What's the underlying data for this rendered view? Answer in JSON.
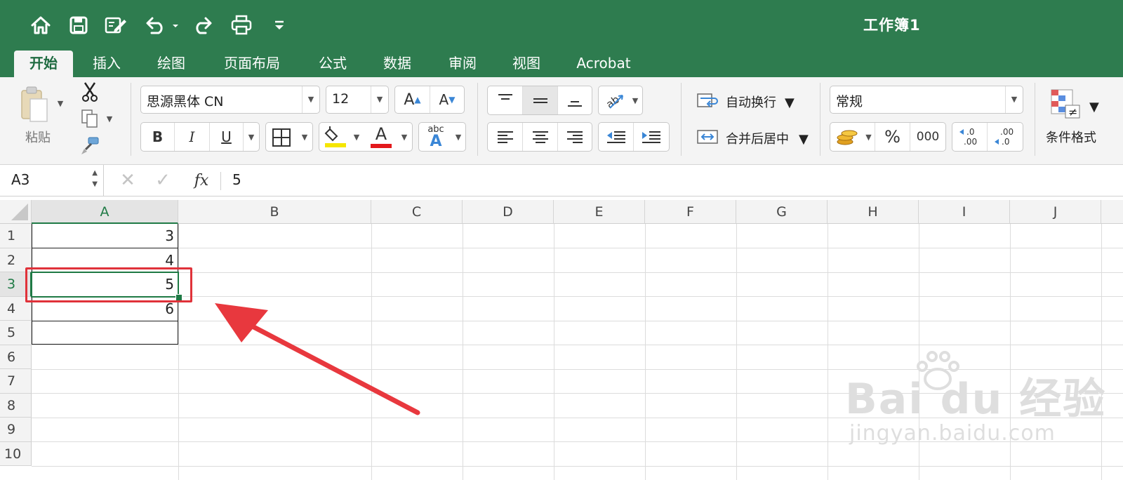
{
  "title_bar": {
    "workbook_title": "工作簿1",
    "quick_access": [
      "home-icon",
      "save-icon",
      "edit-icon",
      "undo-icon",
      "redo-icon",
      "print-icon",
      "customize-icon"
    ],
    "background": "#2e7c4f"
  },
  "tabs": [
    {
      "label": "开始",
      "active": true
    },
    {
      "label": "插入"
    },
    {
      "label": "绘图"
    },
    {
      "label": "页面布局"
    },
    {
      "label": "公式"
    },
    {
      "label": "数据"
    },
    {
      "label": "审阅"
    },
    {
      "label": "视图"
    },
    {
      "label": "Acrobat"
    }
  ],
  "ribbon": {
    "paste_label": "粘贴",
    "font_name": "思源黑体 CN",
    "font_size": "12",
    "bold": "B",
    "italic": "I",
    "underline": "U",
    "font_color_glyph": "A",
    "phonetic_glyph": "abc",
    "wrap_text": "自动换行",
    "merge_center": "合并后居中",
    "number_format": "常规",
    "percent": "%",
    "comma": "000",
    "conditional_format": "条件格式"
  },
  "formula_bar": {
    "name_box": "A3",
    "fx": "fx",
    "value": "5"
  },
  "sheet": {
    "columns": [
      "A",
      "B",
      "C",
      "D",
      "E",
      "F",
      "G",
      "H",
      "I",
      "J"
    ],
    "rows": [
      "1",
      "2",
      "3",
      "4",
      "5",
      "6",
      "7",
      "8",
      "9",
      "10"
    ],
    "cells": {
      "A1": "3",
      "A2": "4",
      "A3": "5",
      "A4": "6"
    },
    "selected_cell": "A3",
    "highlight_color": "#e0323a",
    "selection_color": "#1f7a45"
  },
  "watermark": {
    "brand": "Bai du 经验",
    "url": "jingyan.baidu.com"
  }
}
